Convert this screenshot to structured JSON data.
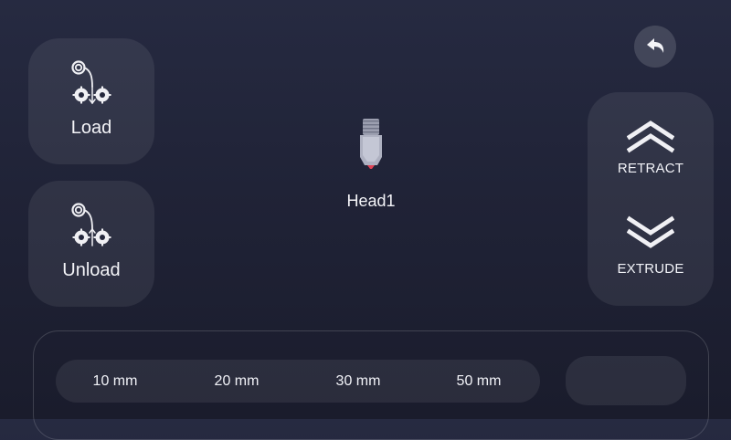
{
  "buttons": {
    "load": "Load",
    "unload": "Unload",
    "retract": "RETRACT",
    "extrude": "EXTRUDE"
  },
  "head": {
    "label": "Head1"
  },
  "distances": [
    "10 mm",
    "20 mm",
    "30 mm",
    "50 mm"
  ],
  "icons": {
    "load": "filament-load-icon",
    "unload": "filament-unload-icon",
    "back": "back-arrow-icon",
    "retract": "double-chevron-up-icon",
    "extrude": "double-chevron-down-icon",
    "head": "extruder-nozzle-icon"
  },
  "colors": {
    "background_top": "#262a41",
    "background_bottom": "#1a1c2c",
    "nozzle_tip": "#e04356"
  }
}
